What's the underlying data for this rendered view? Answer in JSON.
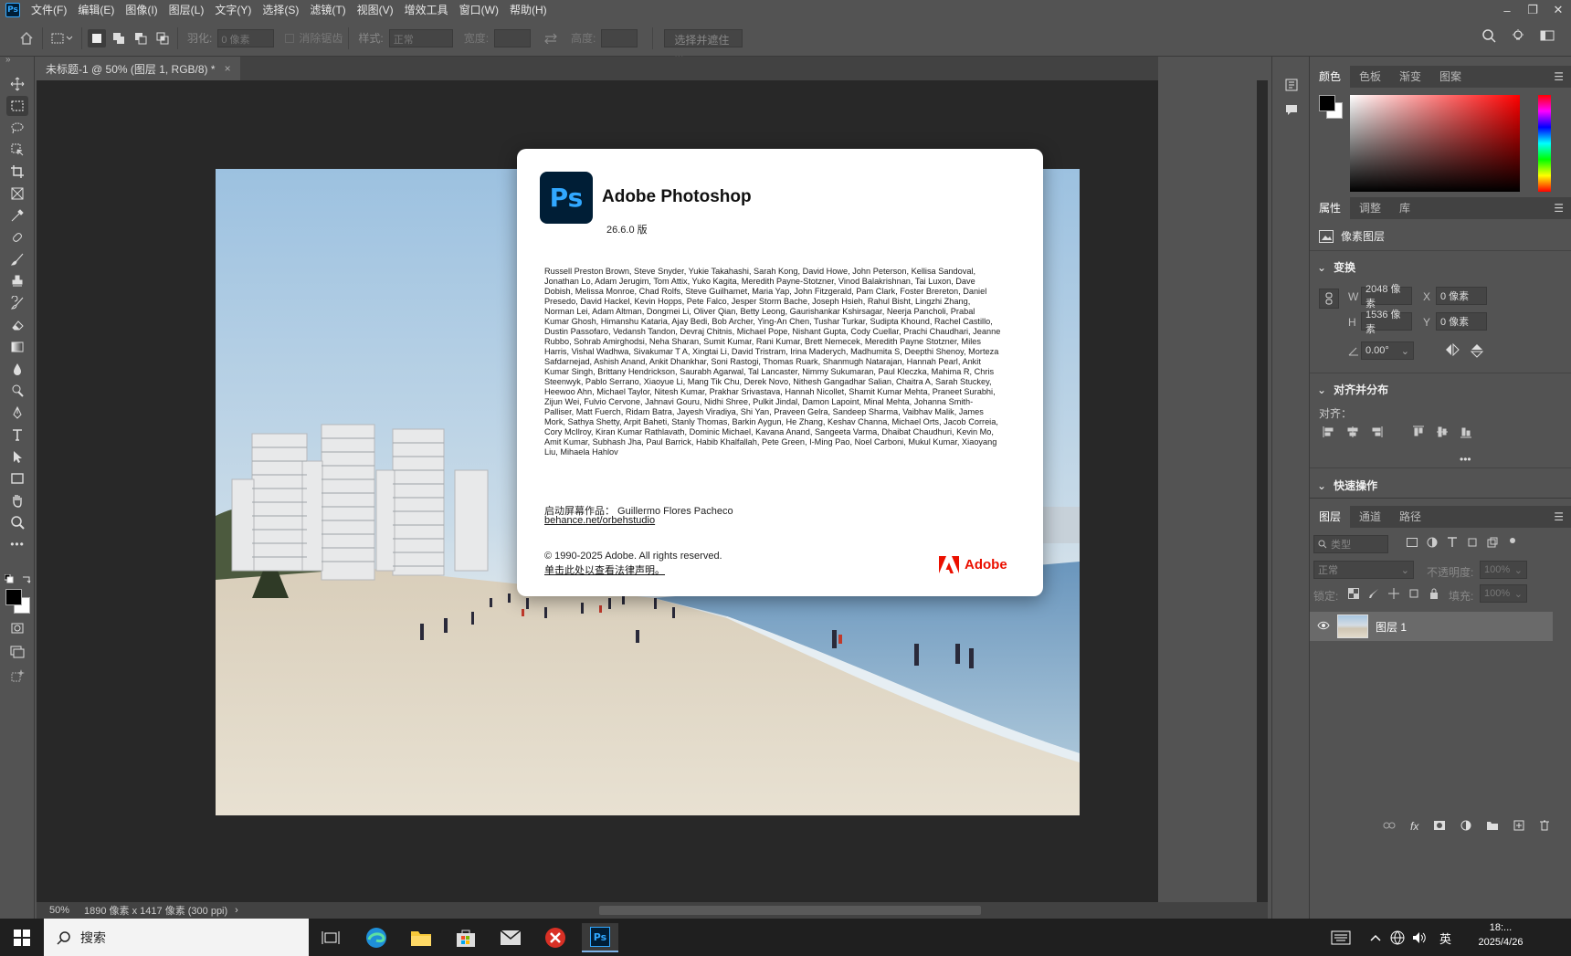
{
  "menubar": {
    "app_icon": "Ps",
    "items": [
      "文件(F)",
      "编辑(E)",
      "图像(I)",
      "图层(L)",
      "文字(Y)",
      "选择(S)",
      "滤镜(T)",
      "视图(V)",
      "增效工具",
      "窗口(W)",
      "帮助(H)"
    ]
  },
  "options": {
    "feather_label": "羽化:",
    "feather_value": "0 像素",
    "antialias_label": "消除锯齿",
    "style_label": "样式:",
    "style_value": "正常",
    "width_label": "宽度:",
    "height_label": "高度:",
    "select_mask_label": "选择并遮住 ..."
  },
  "document": {
    "tab_title": "未标题-1 @ 50% (图层 1, RGB/8) *",
    "close": "×"
  },
  "status": {
    "zoom": "50%",
    "info": "1890 像素 x 1417 像素 (300 ppi)",
    "arrow": "›"
  },
  "color_panel": {
    "tabs": [
      "颜色",
      "色板",
      "渐变",
      "图案"
    ],
    "active_tab": 0
  },
  "properties_panel": {
    "tabs": [
      "属性",
      "调整",
      "库"
    ],
    "layer_type": "像素图层",
    "transform_title": "变换",
    "w_label": "W",
    "w_value": "2048 像素",
    "x_label": "X",
    "x_value": "0 像素",
    "h_label": "H",
    "h_value": "1536 像素",
    "y_label": "Y",
    "y_value": "0 像素",
    "angle_value": "0.00°",
    "align_title": "对齐并分布",
    "align_label": "对齐：",
    "more": "•••",
    "quick_actions_title": "快速操作"
  },
  "layers_panel": {
    "tabs": [
      "图层",
      "通道",
      "路径"
    ],
    "filter_placeholder": "类型",
    "blend_mode": "正常",
    "opacity_label": "不透明度:",
    "opacity_value": "100%",
    "lock_label": "锁定:",
    "fill_label": "填充:",
    "fill_value": "100%",
    "layers": [
      {
        "name": "图层 1",
        "visible": true
      }
    ]
  },
  "about": {
    "logo": "Ps",
    "title": "Adobe Photoshop",
    "version": "26.6.0 版",
    "credits": "Russell Preston Brown, Steve Snyder, Yukie Takahashi, Sarah Kong, David Howe, John Peterson, Kellisa Sandoval, Jonathan Lo, Adam Jerugim, Tom Attix, Yuko Kagita, Meredith Payne-Stotzner, Vinod Balakrishnan, Tai Luxon, Dave Dobish, Melissa Monroe, Chad Rolfs, Steve Guilhamet, Maria Yap, John Fitzgerald, Pam Clark, Foster Brereton, Daniel Presedo, David Hackel, Kevin Hopps, Pete Falco, Jesper Storm Bache, Joseph Hsieh, Rahul Bisht, Lingzhi Zhang, Norman Lei, Adam Altman, Dongmei Li, Oliver Qian, Betty Leong, Gaurishankar Kshirsagar, Neerja Pancholi, Prabal Kumar Ghosh, Himanshu Kataria, Ajay Bedi, Bob Archer, Ying-An Chen, Tushar Turkar, Sudipta Khound, Rachel Castillo, Dustin Passofaro, Vedansh Tandon, Devraj Chitnis, Michael Pope, Nishant Gupta, Cody Cuellar, Prachi Chaudhari, Jeanne Rubbo, Sohrab Amirghodsi, Neha Sharan, Sumit Kumar, Rani Kumar, Brett Nemecek, Meredith Payne Stotzner, Miles Harris, Vishal Wadhwa, Sivakumar T A, Xingtai Li, David Tristram, Irina Maderych, Madhumita S, Deepthi Shenoy, Morteza Safdarnejad, Ashish Anand, Ankit Dhankhar, Soni Rastogi, Thomas Ruark, Shanmugh Natarajan, Hannah Pearl, Ankit Kumar Singh, Brittany Hendrickson, Saurabh Agarwal, Tal Lancaster, Nimmy Sukumaran, Paul Kleczka, Mahima R, Chris Steenwyk, Pablo Serrano, Xiaoyue Li, Mang Tik Chu, Derek Novo, Nithesh Gangadhar Salian, Chaitra A, Sarah Stuckey, Heewoo Ahn, Michael Taylor, Nitesh Kumar, Prakhar Srivastava, Hannah Nicollet, Shamit Kumar Mehta, Praneet Surabhi, Zijun Wei, Fulvio Cervone, Jahnavi Gouru, Nidhi Shree, Pulkit Jindal, Damon Lapoint, Minal Mehta, Johanna Smith-Palliser, Matt Fuerch, Ridam Batra, Jayesh Viradiya, Shi Yan, Praveen Gelra, Sandeep Sharma, Vaibhav Malik, James Mork, Sathya Shetty, Arpit Baheti, Stanly Thomas, Barkin Aygun, He Zhang, Keshav Channa, Michael Orts, Jacob Correia, Cory McIlroy, Kiran Kumar Rathlavath, Dominic Michael, Kavana Anand, Sangeeta Varma, Dhaibat Chaudhuri, Kevin Mo, Amit Kumar, Subhash Jha, Paul Barrick, Habib Khalfallah, Pete Green, I-Ming Pao, Noel Carboni, Mukul Kumar, Xiaoyang Liu, Mihaela Hahlov",
    "splash_label": "启动屏幕作品：  Guillermo Flores Pacheco",
    "splash_link": "behance.net/orbehstudio",
    "copyright": "© 1990-2025 Adobe. All rights reserved.",
    "legal_link": "单击此处以查看法律声明。",
    "adobe": "Adobe"
  },
  "taskbar": {
    "search_placeholder": "搜索",
    "ime": "英",
    "clock_date": "2025/4/26",
    "clock_time": "18:..."
  }
}
